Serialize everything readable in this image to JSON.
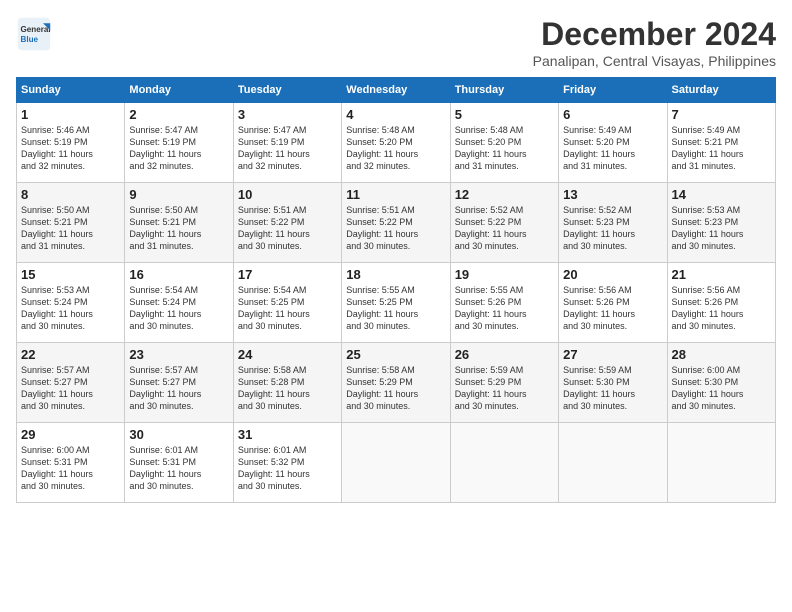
{
  "header": {
    "logo_line1": "General",
    "logo_line2": "Blue",
    "title": "December 2024",
    "subtitle": "Panalipan, Central Visayas, Philippines"
  },
  "columns": [
    "Sunday",
    "Monday",
    "Tuesday",
    "Wednesday",
    "Thursday",
    "Friday",
    "Saturday"
  ],
  "weeks": [
    [
      {
        "day": "1",
        "info": "Sunrise: 5:46 AM\nSunset: 5:19 PM\nDaylight: 11 hours\nand 32 minutes."
      },
      {
        "day": "2",
        "info": "Sunrise: 5:47 AM\nSunset: 5:19 PM\nDaylight: 11 hours\nand 32 minutes."
      },
      {
        "day": "3",
        "info": "Sunrise: 5:47 AM\nSunset: 5:19 PM\nDaylight: 11 hours\nand 32 minutes."
      },
      {
        "day": "4",
        "info": "Sunrise: 5:48 AM\nSunset: 5:20 PM\nDaylight: 11 hours\nand 32 minutes."
      },
      {
        "day": "5",
        "info": "Sunrise: 5:48 AM\nSunset: 5:20 PM\nDaylight: 11 hours\nand 31 minutes."
      },
      {
        "day": "6",
        "info": "Sunrise: 5:49 AM\nSunset: 5:20 PM\nDaylight: 11 hours\nand 31 minutes."
      },
      {
        "day": "7",
        "info": "Sunrise: 5:49 AM\nSunset: 5:21 PM\nDaylight: 11 hours\nand 31 minutes."
      }
    ],
    [
      {
        "day": "8",
        "info": "Sunrise: 5:50 AM\nSunset: 5:21 PM\nDaylight: 11 hours\nand 31 minutes."
      },
      {
        "day": "9",
        "info": "Sunrise: 5:50 AM\nSunset: 5:21 PM\nDaylight: 11 hours\nand 31 minutes."
      },
      {
        "day": "10",
        "info": "Sunrise: 5:51 AM\nSunset: 5:22 PM\nDaylight: 11 hours\nand 30 minutes."
      },
      {
        "day": "11",
        "info": "Sunrise: 5:51 AM\nSunset: 5:22 PM\nDaylight: 11 hours\nand 30 minutes."
      },
      {
        "day": "12",
        "info": "Sunrise: 5:52 AM\nSunset: 5:22 PM\nDaylight: 11 hours\nand 30 minutes."
      },
      {
        "day": "13",
        "info": "Sunrise: 5:52 AM\nSunset: 5:23 PM\nDaylight: 11 hours\nand 30 minutes."
      },
      {
        "day": "14",
        "info": "Sunrise: 5:53 AM\nSunset: 5:23 PM\nDaylight: 11 hours\nand 30 minutes."
      }
    ],
    [
      {
        "day": "15",
        "info": "Sunrise: 5:53 AM\nSunset: 5:24 PM\nDaylight: 11 hours\nand 30 minutes."
      },
      {
        "day": "16",
        "info": "Sunrise: 5:54 AM\nSunset: 5:24 PM\nDaylight: 11 hours\nand 30 minutes."
      },
      {
        "day": "17",
        "info": "Sunrise: 5:54 AM\nSunset: 5:25 PM\nDaylight: 11 hours\nand 30 minutes."
      },
      {
        "day": "18",
        "info": "Sunrise: 5:55 AM\nSunset: 5:25 PM\nDaylight: 11 hours\nand 30 minutes."
      },
      {
        "day": "19",
        "info": "Sunrise: 5:55 AM\nSunset: 5:26 PM\nDaylight: 11 hours\nand 30 minutes."
      },
      {
        "day": "20",
        "info": "Sunrise: 5:56 AM\nSunset: 5:26 PM\nDaylight: 11 hours\nand 30 minutes."
      },
      {
        "day": "21",
        "info": "Sunrise: 5:56 AM\nSunset: 5:26 PM\nDaylight: 11 hours\nand 30 minutes."
      }
    ],
    [
      {
        "day": "22",
        "info": "Sunrise: 5:57 AM\nSunset: 5:27 PM\nDaylight: 11 hours\nand 30 minutes."
      },
      {
        "day": "23",
        "info": "Sunrise: 5:57 AM\nSunset: 5:27 PM\nDaylight: 11 hours\nand 30 minutes."
      },
      {
        "day": "24",
        "info": "Sunrise: 5:58 AM\nSunset: 5:28 PM\nDaylight: 11 hours\nand 30 minutes."
      },
      {
        "day": "25",
        "info": "Sunrise: 5:58 AM\nSunset: 5:29 PM\nDaylight: 11 hours\nand 30 minutes."
      },
      {
        "day": "26",
        "info": "Sunrise: 5:59 AM\nSunset: 5:29 PM\nDaylight: 11 hours\nand 30 minutes."
      },
      {
        "day": "27",
        "info": "Sunrise: 5:59 AM\nSunset: 5:30 PM\nDaylight: 11 hours\nand 30 minutes."
      },
      {
        "day": "28",
        "info": "Sunrise: 6:00 AM\nSunset: 5:30 PM\nDaylight: 11 hours\nand 30 minutes."
      }
    ],
    [
      {
        "day": "29",
        "info": "Sunrise: 6:00 AM\nSunset: 5:31 PM\nDaylight: 11 hours\nand 30 minutes."
      },
      {
        "day": "30",
        "info": "Sunrise: 6:01 AM\nSunset: 5:31 PM\nDaylight: 11 hours\nand 30 minutes."
      },
      {
        "day": "31",
        "info": "Sunrise: 6:01 AM\nSunset: 5:32 PM\nDaylight: 11 hours\nand 30 minutes."
      },
      {
        "day": "",
        "info": ""
      },
      {
        "day": "",
        "info": ""
      },
      {
        "day": "",
        "info": ""
      },
      {
        "day": "",
        "info": ""
      }
    ]
  ]
}
